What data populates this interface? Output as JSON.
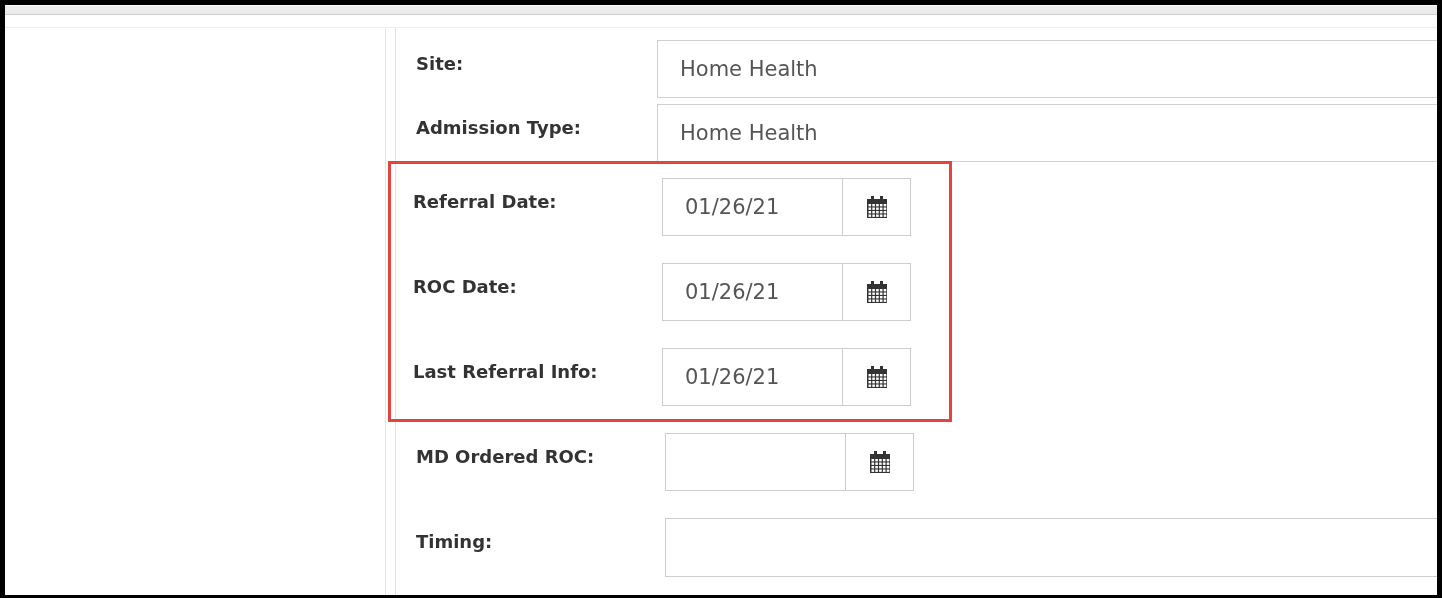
{
  "form": {
    "fields": [
      {
        "kind": "select",
        "label": "Site:",
        "value": "Home Health",
        "highlighted": false
      },
      {
        "kind": "select",
        "label": "Admission Type:",
        "value": "Home Health",
        "highlighted": false
      },
      {
        "kind": "date",
        "label": "Referral Date:",
        "value": "01/26/21",
        "highlighted": true
      },
      {
        "kind": "date",
        "label": "ROC Date:",
        "value": "01/26/21",
        "highlighted": true
      },
      {
        "kind": "date",
        "label": "Last Referral Info:",
        "value": "01/26/21",
        "highlighted": true
      },
      {
        "kind": "date",
        "label": "MD Ordered ROC:",
        "highlighted": false
      },
      {
        "kind": "text",
        "label": "Timing:",
        "highlighted": false
      }
    ]
  }
}
